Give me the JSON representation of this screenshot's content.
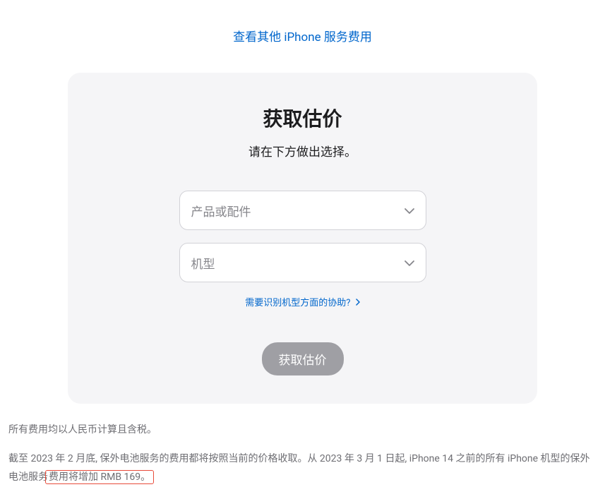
{
  "topLink": {
    "text": "查看其他 iPhone 服务费用"
  },
  "card": {
    "title": "获取估价",
    "subtitle": "请在下方做出选择。",
    "select1": {
      "placeholder": "产品或配件"
    },
    "select2": {
      "placeholder": "机型"
    },
    "helpLink": {
      "text": "需要识别机型方面的协助?"
    },
    "button": {
      "label": "获取估价"
    }
  },
  "footer": {
    "paragraph1": "所有费用均以人民币计算且含税。",
    "paragraph2_part1": "截至 2023 年 2 月底, 保外电池服务的费用都将按照当前的价格收取。从 2023 年 3 月 1 日起, iPhone 14 之前的所有 iPhone 机型的保外电池服务",
    "paragraph2_highlight": "费用将增加 RMB 169。"
  }
}
